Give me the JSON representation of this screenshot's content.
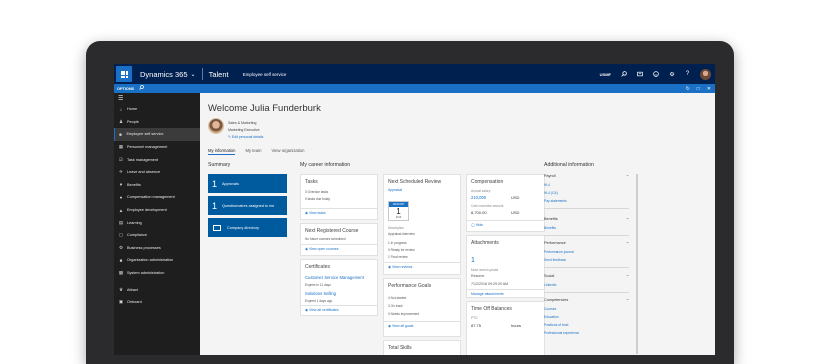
{
  "topbar": {
    "app_name": "Dynamics 365",
    "module_name": "Talent",
    "page_name": "Employee self service",
    "company": "USMF",
    "help_label": "?"
  },
  "optionsbar": {
    "label": "OPTIONS"
  },
  "sidebar": {
    "items": [
      {
        "label": "Home",
        "icon": "home-icon"
      },
      {
        "label": "People",
        "icon": "people-icon"
      },
      {
        "label": "Employee self service",
        "icon": "self-service-icon"
      },
      {
        "label": "Personnel management",
        "icon": "personnel-icon"
      },
      {
        "label": "Task management",
        "icon": "task-icon"
      },
      {
        "label": "Leave and absence",
        "icon": "leave-icon"
      },
      {
        "label": "Benefits",
        "icon": "benefits-icon"
      },
      {
        "label": "Compensation management",
        "icon": "compensation-icon"
      },
      {
        "label": "Employee development",
        "icon": "development-icon"
      },
      {
        "label": "Learning",
        "icon": "learning-icon"
      },
      {
        "label": "Compliance",
        "icon": "compliance-icon"
      },
      {
        "label": "Business processes",
        "icon": "processes-icon"
      },
      {
        "label": "Organization administration",
        "icon": "org-admin-icon"
      },
      {
        "label": "System administration",
        "icon": "sys-admin-icon"
      },
      {
        "label": "Attract",
        "icon": "attract-icon"
      },
      {
        "label": "Onboard",
        "icon": "onboard-icon"
      }
    ]
  },
  "profile": {
    "welcome": "Welcome Julia Funderburk",
    "department": "Sales & Marketing",
    "title": "Marketing Executive",
    "edit_link": "Edit personal details"
  },
  "tabs": [
    "My information",
    "My team",
    "View organization"
  ],
  "summary": {
    "title": "Summary",
    "tiles": [
      {
        "count": "1",
        "label": "Approvals"
      },
      {
        "count": "1",
        "label": "Questionnaires assigned to me"
      },
      {
        "count": "",
        "label": "Company directory"
      }
    ]
  },
  "career": {
    "title": "My career information",
    "tasks": {
      "title": "Tasks",
      "line1": "3 Overdue tasks",
      "line2": "0 tasks due today",
      "link": "View tasks"
    },
    "course": {
      "title": "Next Registered Course",
      "line1": "No future courses scheduled",
      "link": "View open courses"
    },
    "certificates": {
      "title": "Certificates",
      "name": "Customer Service Management",
      "expires": "Expires in 11 days",
      "name2": "Solutions Selling",
      "expired": "Expired 1 days ago",
      "link": "View all certificates"
    },
    "review": {
      "title": "Next Scheduled Review",
      "type": "Appraisal",
      "cal_month": "JANUARY",
      "cal_day": "1",
      "cal_year": "2019",
      "desc_label": "Description",
      "desc": "Appraisal interview",
      "line1": "1 In progress",
      "line2": "0 Ready for review",
      "line3": "1 Final review",
      "link": "View reviews"
    },
    "goals": {
      "title": "Performance Goals",
      "line1": "4 Not started",
      "line2": "3 On track",
      "line3": "0 Needs improvement",
      "link": "View all goals"
    },
    "skills": {
      "title": "Total Skills"
    },
    "compensation": {
      "title": "Compensation",
      "salary_label": "Annual salary",
      "salary": "210,000",
      "cur1": "USD",
      "bonus_label": "Cash incentive amount",
      "bonus": "8,700.00",
      "cur2": "USD",
      "toggle": "Hide"
    },
    "attachments": {
      "title": "Attachments",
      "count": "1",
      "recent_label": "Most recent upload",
      "recent": "Resume",
      "date": "7/12/2018 09:29:20 AM",
      "link": "Manage attachments"
    },
    "timeoff": {
      "title": "Time Off Balances",
      "line1": "PTO",
      "value": "87.75",
      "unit": "hours"
    }
  },
  "additional": {
    "title": "Additional information",
    "groups": [
      {
        "header": "Payroll",
        "links": [
          "W-4",
          "W-4 (CA)",
          "Pay statements"
        ]
      },
      {
        "header": "Benefits",
        "links": [
          "Benefits"
        ]
      },
      {
        "header": "Performance",
        "links": [
          "Performance journal",
          "Send feedback"
        ]
      },
      {
        "header": "Social",
        "links": [
          "LinkedIn"
        ]
      },
      {
        "header": "Competencies",
        "links": [
          "Courses",
          "Education",
          "Positions of trust",
          "Professional experience"
        ]
      }
    ]
  }
}
